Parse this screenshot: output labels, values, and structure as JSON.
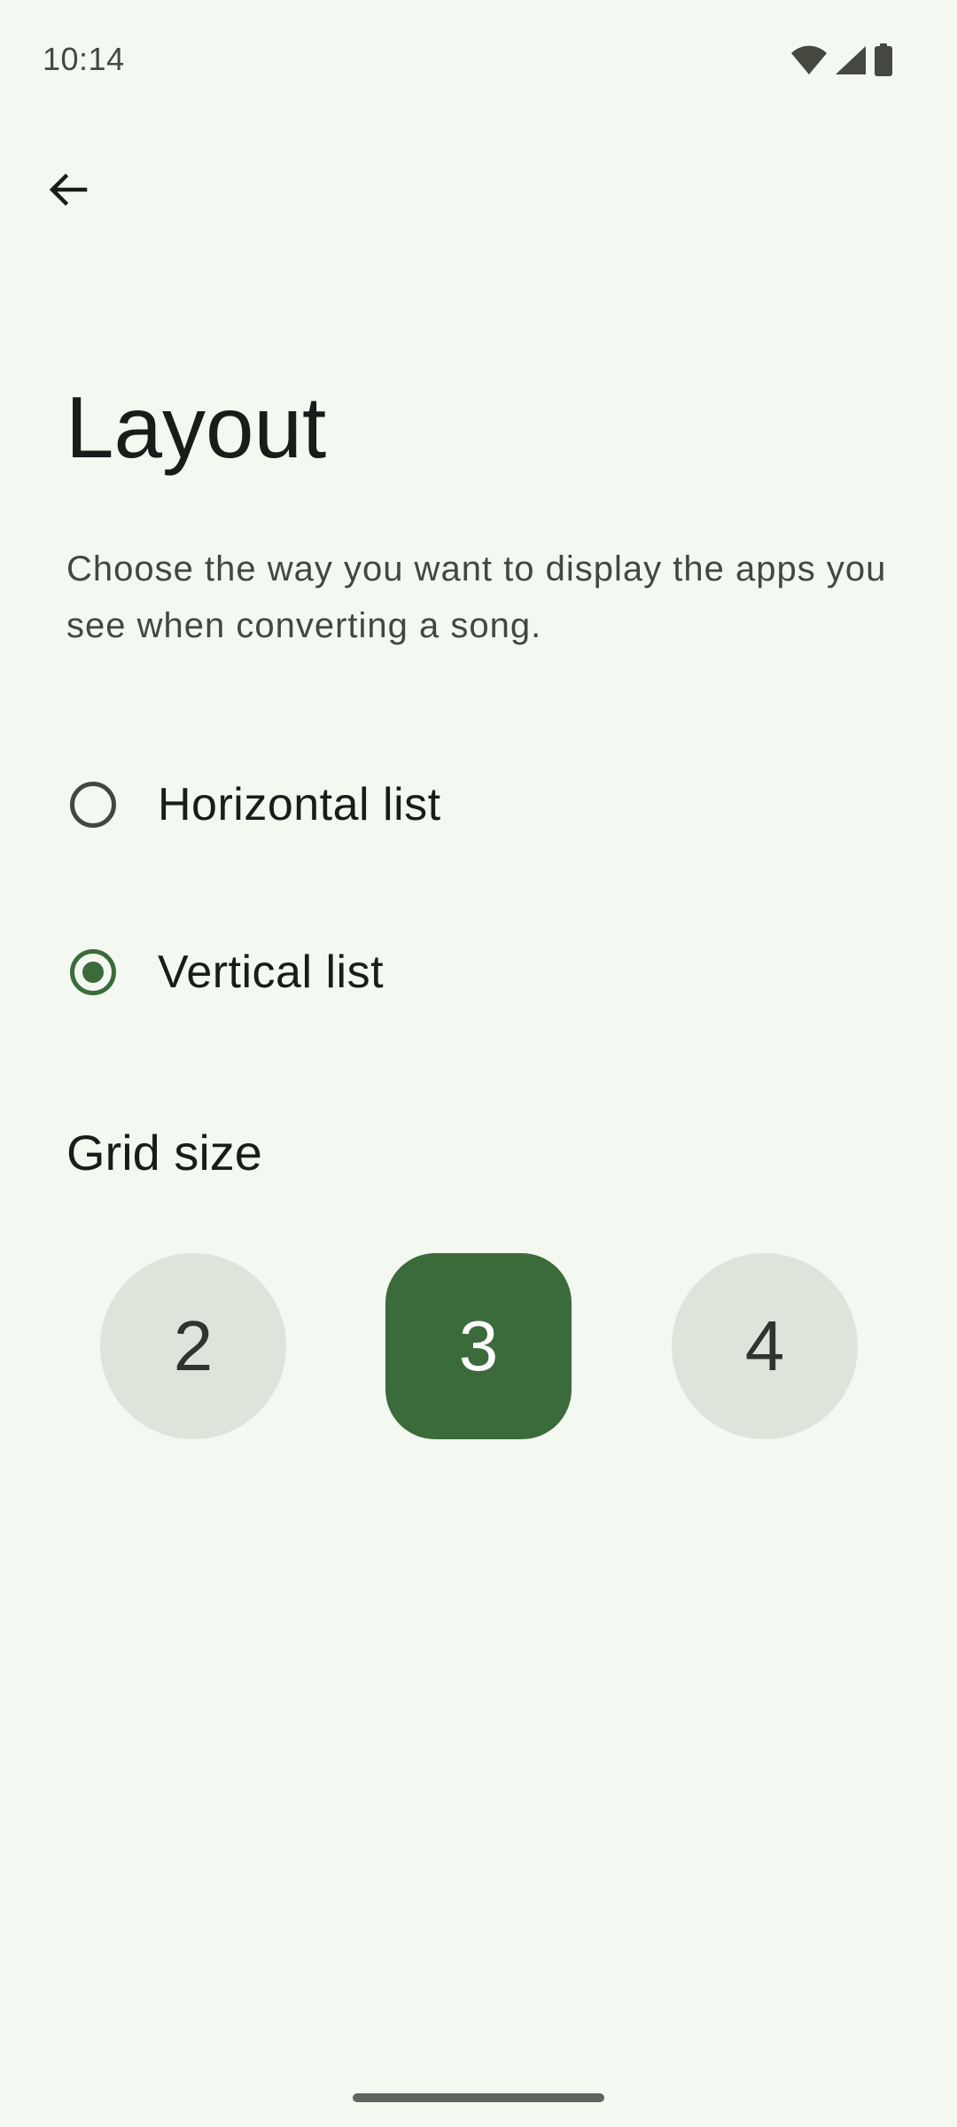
{
  "status_bar": {
    "time": "10:14",
    "icons": [
      "wifi-icon",
      "cellular-signal-icon",
      "battery-icon"
    ]
  },
  "toolbar": {
    "back_icon": "arrow-back-icon"
  },
  "page": {
    "title": "Layout",
    "description": "Choose the way you want to display the apps you see when converting a song."
  },
  "layout_options": [
    {
      "label": "Horizontal list",
      "selected": false
    },
    {
      "label": "Vertical list",
      "selected": true
    }
  ],
  "grid_size": {
    "title": "Grid size",
    "options": [
      "2",
      "3",
      "4"
    ],
    "selected": "3"
  },
  "colors": {
    "background": "#f3f8f1",
    "accent": "#3b6b3b",
    "chip_unselected": "#dfe4da",
    "text_primary": "#1a1c19",
    "text_secondary": "#43483f"
  }
}
